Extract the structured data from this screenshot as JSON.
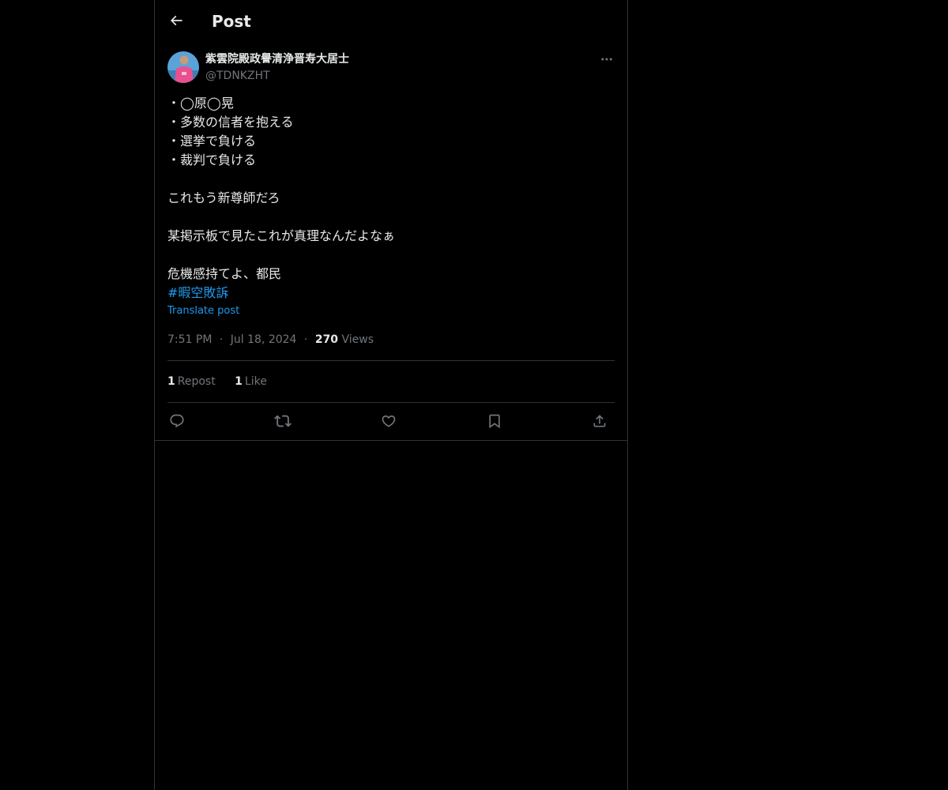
{
  "header": {
    "title": "Post",
    "back_icon": "arrow-left-icon"
  },
  "author": {
    "display_name": "紫雲院殿政譽清浄晋寿大居士",
    "handle": "@TDNKZHT",
    "avatar": "avatar-photo"
  },
  "post": {
    "lines": [
      "・◯原◯晃",
      "・多数の信者を抱える",
      "・選挙で負ける",
      "・裁判で負ける",
      "",
      "これもう新尊師だろ",
      "",
      "某掲示板で見たこれが真理なんだよなぁ",
      "",
      "危機感持てよ、都民"
    ],
    "hashtag": "#暇空敗訴",
    "translate_label": "Translate post"
  },
  "meta": {
    "time": "7:51 PM",
    "separator": "·",
    "date": "Jul 18, 2024",
    "views_count": "270",
    "views_label": "Views"
  },
  "stats": {
    "reposts_count": "1",
    "reposts_label": "Repost",
    "likes_count": "1",
    "likes_label": "Like"
  },
  "actions": [
    "reply-icon",
    "repost-icon",
    "like-icon",
    "bookmark-icon",
    "share-icon"
  ],
  "colors": {
    "background": "#000000",
    "text": "#e7e9ea",
    "secondary_text": "#71767b",
    "link": "#1d9bf0",
    "border": "#2f3336"
  }
}
